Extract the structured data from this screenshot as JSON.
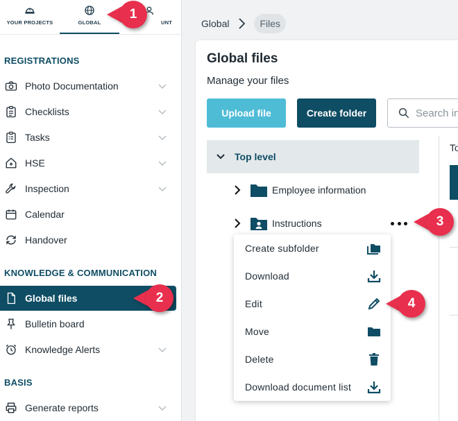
{
  "topnav": {
    "items": [
      {
        "label": "YOUR PROJECTS",
        "icon": "hardhat-icon"
      },
      {
        "label": "GLOBAL",
        "icon": "globe-icon"
      },
      {
        "label": "UNT",
        "icon": "account-icon"
      }
    ]
  },
  "sidebar": {
    "registrations_title": "REGISTRATIONS",
    "registrations": [
      {
        "label": "Photo Documentation",
        "icon": "camera-icon"
      },
      {
        "label": "Checklists",
        "icon": "checklist-icon"
      },
      {
        "label": "Tasks",
        "icon": "tasks-icon"
      },
      {
        "label": "HSE",
        "icon": "house-plus-icon"
      },
      {
        "label": "Inspection",
        "icon": "wrench-icon"
      },
      {
        "label": "Calendar",
        "icon": "calendar-icon"
      },
      {
        "label": "Handover",
        "icon": "sync-icon"
      }
    ],
    "knowledge_title": "KNOWLEDGE & COMMUNICATION",
    "knowledge": [
      {
        "label": "Global files",
        "icon": "file-icon"
      },
      {
        "label": "Bulletin board",
        "icon": "pin-icon"
      },
      {
        "label": "Knowledge Alerts",
        "icon": "clock-alert-icon"
      }
    ],
    "basis_title": "BASIS",
    "basis": [
      {
        "label": "Generate reports",
        "icon": "printer-icon"
      }
    ]
  },
  "breadcrumb": {
    "root": "Global",
    "current": "Files"
  },
  "main": {
    "title": "Global files",
    "subtitle": "Manage your files",
    "upload_label": "Upload file",
    "create_folder_label": "Create folder",
    "search_placeholder": "Search in",
    "right_col_text": "To"
  },
  "tree": {
    "top_level": "Top level",
    "folders": [
      {
        "label": "Employee information",
        "icon": "folder-icon"
      },
      {
        "label": "Instructions",
        "icon": "folder-user-icon"
      }
    ]
  },
  "context_menu": {
    "items": [
      {
        "label": "Create subfolder",
        "icon": "folders-icon"
      },
      {
        "label": "Download",
        "icon": "download-icon"
      },
      {
        "label": "Edit",
        "icon": "pencil-icon"
      },
      {
        "label": "Move",
        "icon": "folder-icon"
      },
      {
        "label": "Delete",
        "icon": "trash-icon"
      },
      {
        "label": "Download document list",
        "icon": "download-icon"
      }
    ]
  },
  "callouts": [
    "1",
    "2",
    "3",
    "4"
  ],
  "colors": {
    "primary": "#0e4d64",
    "accent": "#4fbcd6",
    "callout": "#e8304e"
  }
}
